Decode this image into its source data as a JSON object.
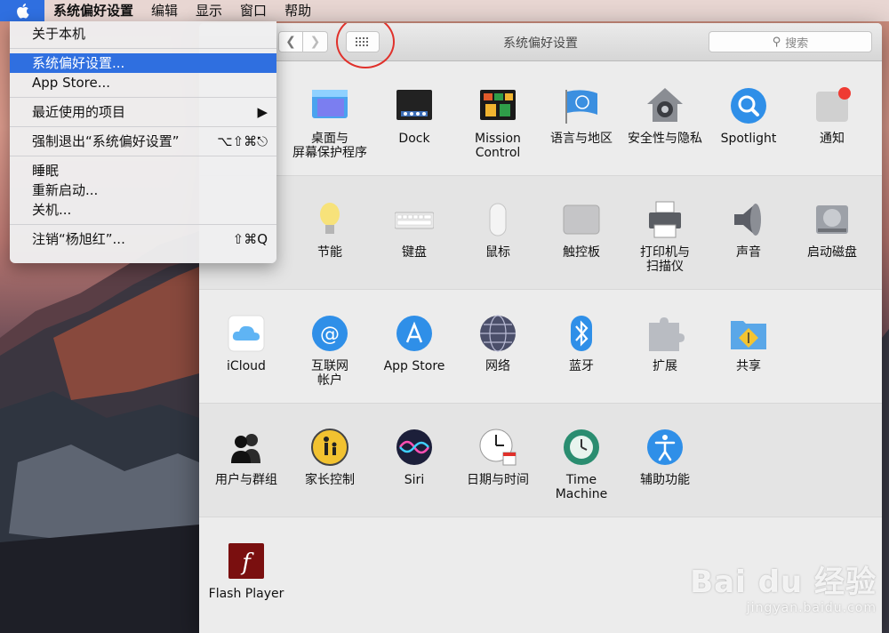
{
  "menubar": {
    "apple_icon": "apple-logo-icon",
    "items": [
      "系统偏好设置",
      "编辑",
      "显示",
      "窗口",
      "帮助"
    ]
  },
  "apple_menu": {
    "items": [
      {
        "label": "关于本机",
        "shortcut": ""
      },
      {
        "label": "系统偏好设置...",
        "shortcut": "",
        "selected": true
      },
      {
        "label": "App Store...",
        "shortcut": ""
      },
      {
        "label": "最近使用的项目",
        "shortcut": "▶"
      },
      {
        "label": "强制退出“系统偏好设置”",
        "shortcut": "⌥⇧⌘⎋"
      },
      {
        "label": "睡眠",
        "shortcut": ""
      },
      {
        "label": "重新启动...",
        "shortcut": ""
      },
      {
        "label": "关机...",
        "shortcut": ""
      },
      {
        "label": "注销“杨旭红”...",
        "shortcut": "⇧⌘Q"
      }
    ]
  },
  "window": {
    "title": "系统偏好设置",
    "search_placeholder": "搜索",
    "back_icon": "chevron-left-icon",
    "forward_icon": "chevron-right-icon",
    "grid_icon": "show-all-grid-icon",
    "highlight_color": "#e0312b"
  },
  "sections": [
    {
      "panes": [
        {
          "label": "桌面与\n屏幕保护程序",
          "icon": "desktop-screensaver-icon"
        },
        {
          "label": "Dock",
          "icon": "dock-icon"
        },
        {
          "label": "Mission\nControl",
          "icon": "mission-control-icon"
        },
        {
          "label": "语言与地区",
          "icon": "language-region-icon"
        },
        {
          "label": "安全性与隐私",
          "icon": "security-privacy-icon"
        },
        {
          "label": "Spotlight",
          "icon": "spotlight-icon"
        },
        {
          "label": "通知",
          "icon": "notifications-icon"
        }
      ]
    },
    {
      "panes": [
        {
          "label": "节能",
          "icon": "energy-saver-icon"
        },
        {
          "label": "键盘",
          "icon": "keyboard-icon"
        },
        {
          "label": "鼠标",
          "icon": "mouse-icon"
        },
        {
          "label": "触控板",
          "icon": "trackpad-icon"
        },
        {
          "label": "打印机与\n扫描仪",
          "icon": "printer-scanner-icon"
        },
        {
          "label": "声音",
          "icon": "sound-icon"
        },
        {
          "label": "启动磁盘",
          "icon": "startup-disk-icon"
        }
      ]
    },
    {
      "panes": [
        {
          "label": "iCloud",
          "icon": "icloud-icon"
        },
        {
          "label": "互联网\n帐户",
          "icon": "internet-accounts-icon"
        },
        {
          "label": "App Store",
          "icon": "app-store-icon"
        },
        {
          "label": "网络",
          "icon": "network-icon"
        },
        {
          "label": "蓝牙",
          "icon": "bluetooth-icon"
        },
        {
          "label": "扩展",
          "icon": "extensions-icon"
        },
        {
          "label": "共享",
          "icon": "sharing-icon"
        }
      ]
    },
    {
      "panes": [
        {
          "label": "用户与群组",
          "icon": "users-groups-icon"
        },
        {
          "label": "家长控制",
          "icon": "parental-controls-icon"
        },
        {
          "label": "Siri",
          "icon": "siri-icon"
        },
        {
          "label": "日期与时间",
          "icon": "date-time-icon"
        },
        {
          "label": "Time Machine",
          "icon": "time-machine-icon"
        },
        {
          "label": "辅助功能",
          "icon": "accessibility-icon"
        }
      ]
    },
    {
      "panes": [
        {
          "label": "Flash Player",
          "icon": "flash-player-icon"
        }
      ]
    }
  ],
  "watermark": {
    "brand": "Bai du 经验",
    "url": "jingyan.baidu.com"
  }
}
